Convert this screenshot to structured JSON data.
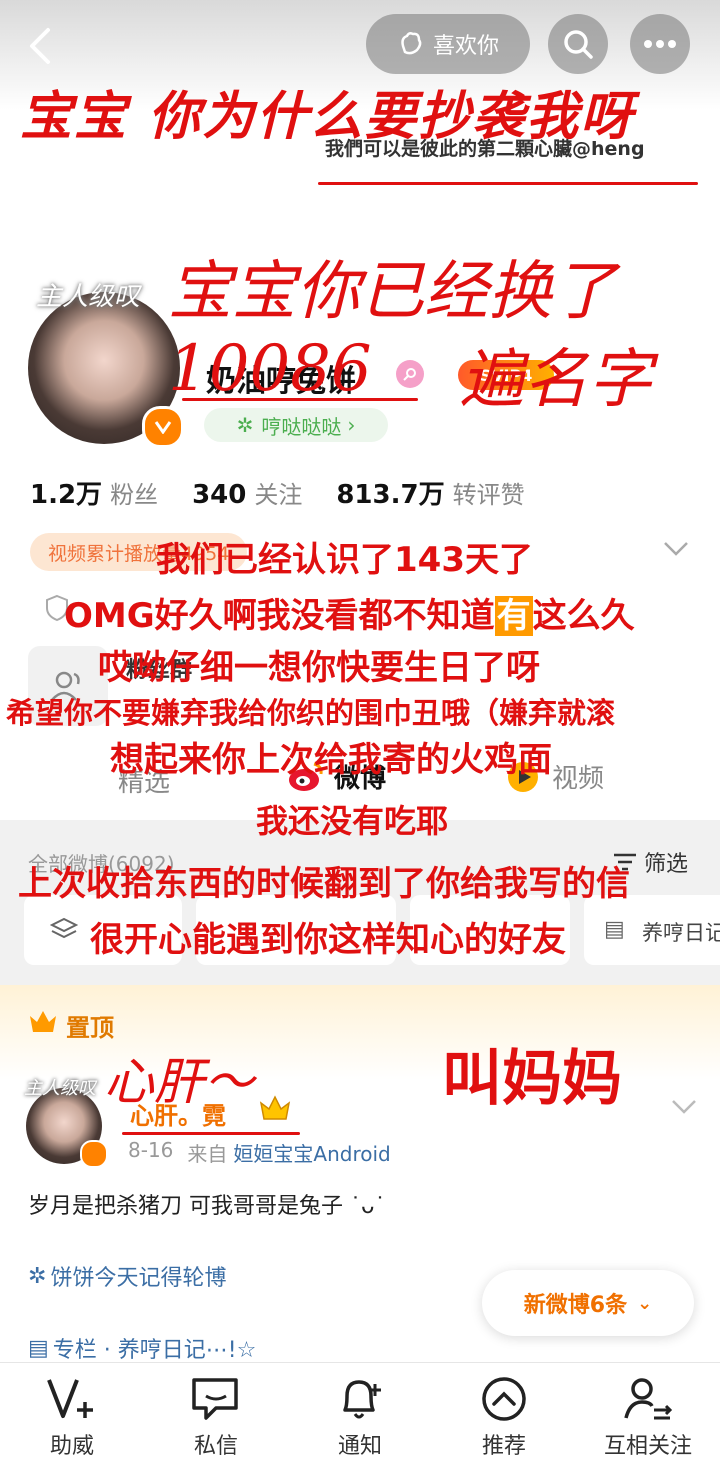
{
  "header": {
    "like_label": "喜欢你"
  },
  "banner": {
    "signature": "我們可以是彼此的第二顆心臟@heng"
  },
  "profile": {
    "avatar_overlay": "主人级叹",
    "name": "奶油哼兔饼",
    "vip_badge": "SVIP4",
    "tag": "哼哒哒哒",
    "stats": [
      {
        "value": "1.2万",
        "label": "粉丝"
      },
      {
        "value": "340",
        "label": "关注"
      },
      {
        "value": "813.7万",
        "label": "转评赞"
      }
    ],
    "video_stats": "视频累计播放量4954",
    "fans_group": "粉丝群"
  },
  "tabs": [
    {
      "label": "精选"
    },
    {
      "label": "微博"
    },
    {
      "label": "视频"
    }
  ],
  "feed": {
    "all_label": "全部微博(6092)",
    "filter_label": "筛选",
    "chips": [
      "",
      "",
      "",
      "养哼日记"
    ]
  },
  "pinned": {
    "label": "置顶",
    "author": "心肝。霓",
    "avatar_overlay": "主人级叹",
    "meta_date": "8-16",
    "meta_from": "来自",
    "meta_source": "姮姮宝宝Android",
    "text": "岁月是把杀猪刀 可我哥哥是兔子 ˙ᴗ˙",
    "topic": "饼饼今天记得轮博",
    "column": "专栏 · 养哼日记⋯!☆",
    "new_posts": "新微博6条"
  },
  "bottom_nav": [
    {
      "label": "助威",
      "icon": "v-plus-icon"
    },
    {
      "label": "私信",
      "icon": "message-icon"
    },
    {
      "label": "通知",
      "icon": "bell-icon"
    },
    {
      "label": "推荐",
      "icon": "chevron-up-circle-icon"
    },
    {
      "label": "互相关注",
      "icon": "mutual-follow-icon"
    }
  ],
  "annotations": {
    "title": "宝宝 你为什么要抄袭我呀",
    "line2": "宝宝你已经换了10086",
    "line3": "遍名字",
    "m1": "我们已经认识了143天了",
    "m2a": "OMG好久啊我没看都不知道",
    "m2b": "有",
    "m2c": "这么久",
    "m3": "哎呦仔细一想你快要生日了呀",
    "m4": "希望你不要嫌弃我给你织的围巾丑哦（嫌弃就滚",
    "m5": "想起来你上次给我寄的火鸡面",
    "m6": "我还没有吃耶",
    "m7": "上次收拾东西的时候翻到了你给我写的信",
    "m8": "很开心能遇到你这样知心的好友",
    "xingan": "心肝～",
    "mama": "叫妈妈"
  },
  "colors": {
    "accent_red": "#e01010",
    "orange": "#ff8200",
    "badge_bg": "#fde6d2"
  }
}
